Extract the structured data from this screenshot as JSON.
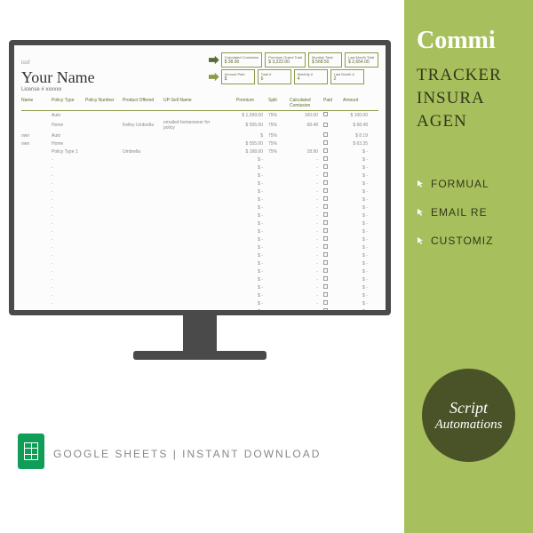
{
  "sidebar": {
    "title": "Commi",
    "lines": [
      "TRACKER",
      "INSURA",
      "AGEN"
    ],
    "features": [
      "FORMUAL",
      "EMAIL RE",
      "CUSTOMIZ"
    ],
    "badge": {
      "l1": "Script",
      "l2": "Automations"
    }
  },
  "footer": "GOOGLE SHEETS | INSTANT DOWNLOAD",
  "sheet": {
    "name": "Your Name",
    "license": "License # xxxxxx",
    "agency_label": "loof",
    "stats": [
      {
        "label": "Calculated\nComission",
        "val": "$ 38.90"
      },
      {
        "label": "Premium\nGrand Total",
        "val": "$ 3,222.00"
      },
      {
        "label": "Monthly Total",
        "val": "$ 568.50"
      },
      {
        "label": "Last Month\nTotal",
        "val": "$ 2,654.00"
      },
      {
        "label": "Amount Paid",
        "val": "$"
      },
      {
        "label": "Total #",
        "val": "6"
      },
      {
        "label": "Monthly #",
        "val": "4"
      },
      {
        "label": "Last Month #",
        "val": "2"
      }
    ],
    "columns": [
      "Name",
      "Policy Type",
      "Policy Number",
      "Product Offered",
      "UP-Sell Name",
      "",
      "Premium",
      "Split",
      "Calculated Comission",
      "Paid",
      "Amount"
    ],
    "rows": [
      {
        "name": "",
        "type": "Auto",
        "prem": "$ 1,599.00",
        "split": "75%",
        "comm": "100.00",
        "amt": "$ 100.00"
      },
      {
        "name": "",
        "type": "Home",
        "prod": "Kelley Umbrella",
        "note": "emailed homeowner for policy",
        "prem": "$ 555.00",
        "split": "75%",
        "comm": "68.48",
        "amt": "$ 68.48"
      },
      {
        "name": "own",
        "type": "Auto",
        "prem": "$",
        "split": "75%",
        "comm": "",
        "amt": "$ 8.19"
      },
      {
        "name": "own",
        "type": "Home",
        "prem": "$ 555.00",
        "split": "75%",
        "comm": "",
        "amt": "$ 63.35"
      },
      {
        "name": "",
        "type": "Policy Type 1",
        "prod": "Umbrella",
        "prem": "$ 168.00",
        "split": "75%",
        "comm": "18.90",
        "amt": "$ -"
      }
    ]
  }
}
